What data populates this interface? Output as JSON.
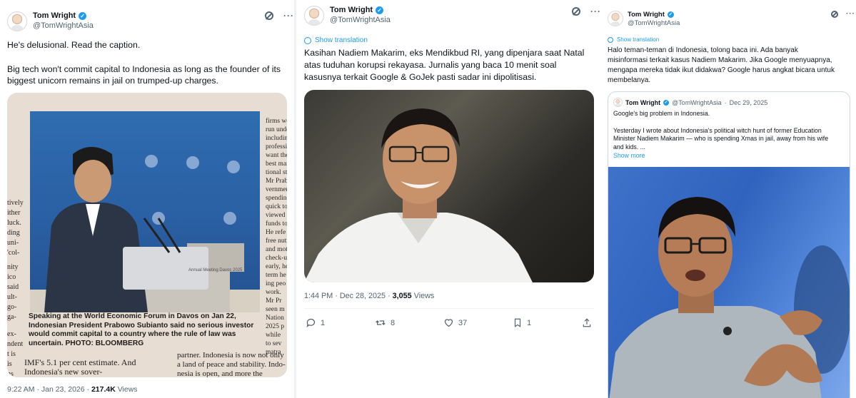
{
  "tweets": [
    {
      "author_name": "Tom Wright",
      "author_handle": "@TomWrightAsia",
      "text_lines": [
        "He's delusional. Read the caption.",
        "Big tech won't commit capital to Indonesia as long as the founder of its",
        "biggest unicorn remains in jail on trumped-up charges."
      ],
      "image": {
        "clipping_left_col": [
          "tively",
          "ither",
          "luck.",
          "ding",
          "uni-",
          "'col-",
          "nity",
          "ico",
          "said",
          "ult-",
          "go-",
          "ga-",
          "ex-",
          "ndent",
          "t is",
          "is",
          "ns"
        ],
        "clipping_right_col": [
          "firms would",
          "run under Ind",
          "including b",
          "professional",
          "want the be",
          "best manag",
          "tional stand",
          "Mr Prabo",
          "vernment",
          "spending,",
          "quick to",
          "viewed as",
          "funds to in",
          "He refe",
          "free nutri",
          "and moth",
          "check-up",
          "early, he",
          "term he",
          "ing peo",
          "work.",
          "Mr Pr",
          "seen m",
          "Nation",
          "2025 p",
          "while",
          "to sev",
          "matra",
          "tentio",
          "At t",
          "porta",
          "law",
          "was",
          "entr"
        ],
        "caption": "Speaking at the World Economic Forum in Davos on Jan 22, Indonesian President Prabowo Subianto said no serious investor would commit capital to a country where the rule of law was uncertain. PHOTO: BLOOMBERG",
        "bottom_left": "IMF's 5.1 per cent estimate. And",
        "bottom_left2": "Indonesia's new sover-",
        "bottom_right": "partner. Indonesia is now not only",
        "bottom_right2": "a land of peace and stability. Indo-",
        "bottom_right3": "nesia is open, and more the",
        "podium_label": "Annual Meeting Davos 2025"
      },
      "time": "9:22 AM",
      "date": "Jan 23, 2026",
      "views_count": "217.4K",
      "views_label": "Views"
    },
    {
      "author_name": "Tom Wright",
      "author_handle": "@TomWrightAsia",
      "show_translation": "Show translation",
      "text_lines": [
        "Kasihan Nadiem Makarim, eks Mendikbud RI, yang dipenjara saat Natal",
        "atas tuduhan korupsi rekayasa. Jurnalis yang baca 10 menit soal",
        "kasusnya terkait Google & GoJek pasti sadar ini dipolitisasi."
      ],
      "time": "1:44 PM",
      "date": "Dec 28, 2025",
      "views_count": "3,055",
      "views_label": "Views",
      "actions": {
        "replies": "1",
        "reposts": "8",
        "likes": "37",
        "bookmarks": "1"
      }
    },
    {
      "author_name": "Tom Wright",
      "author_handle": "@TomWrightAsia",
      "show_translation": "Show translation",
      "text_lines": [
        "Halo teman-teman di Indonesia, tolong baca ini. Ada banyak",
        "misinformasi terkait kasus Nadiem Makarim. Jika Google menyuapnya,",
        "mengapa mereka tidak ikut didakwa? Google harus angkat bicara untuk",
        "membelanya."
      ],
      "quote": {
        "author_name": "Tom Wright",
        "author_handle": "@TomWrightAsia",
        "date": "Dec 29, 2025",
        "line1": "Google's big problem in Indonesia.",
        "line2": "Yesterday I wrote about Indonesia's political witch hunt of former Education",
        "line3": "Minister Nadiem Makarim — who is spending Xmas in jail, away from his wife",
        "line4": "and kids. ...",
        "show_more": "Show more"
      }
    }
  ],
  "colors": {
    "accent": "#1d9bf0",
    "muted": "#536471",
    "text": "#0f1419",
    "border": "#cfd9de"
  }
}
